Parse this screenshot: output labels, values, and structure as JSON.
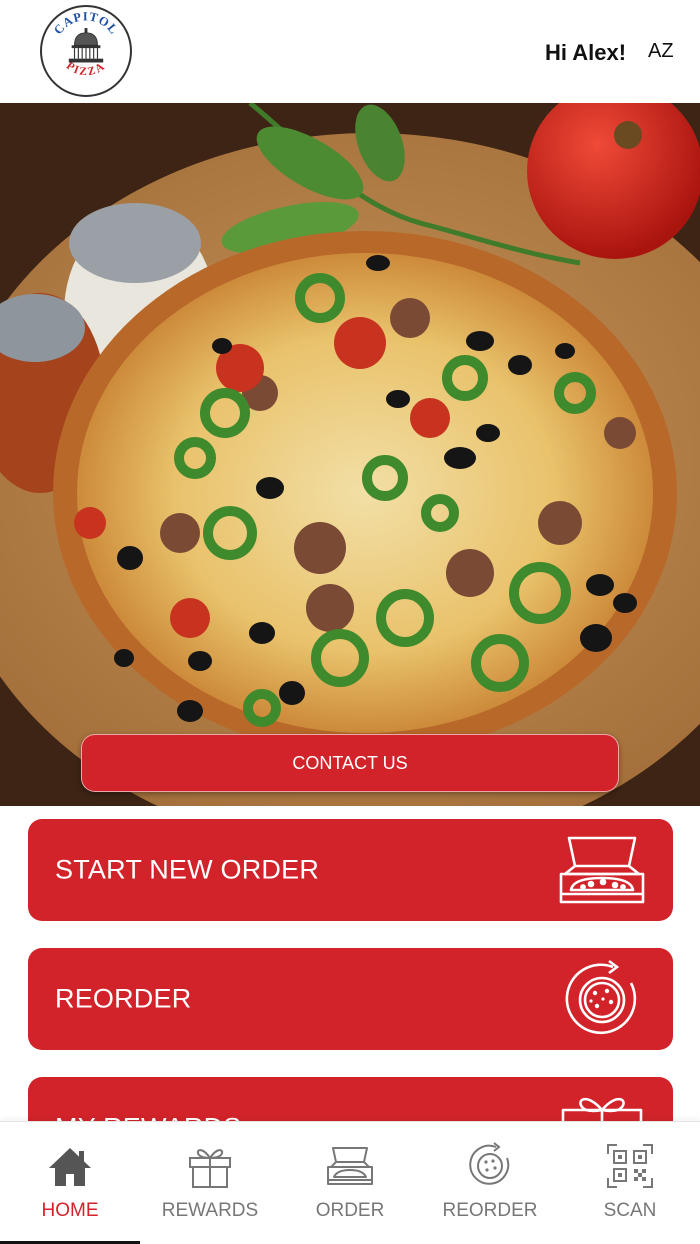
{
  "header": {
    "logo": {
      "top_text": "CAPITOL",
      "bottom_text": "PIZZA",
      "icon": "capitol-dome-icon"
    },
    "greeting": "Hi Alex!",
    "state": "AZ"
  },
  "hero": {
    "image": "pizza-photo",
    "contact_label": "CONTACT US"
  },
  "actions": [
    {
      "label": "START NEW ORDER",
      "icon": "pizza-box-icon"
    },
    {
      "label": "REORDER",
      "icon": "reorder-pizza-icon"
    },
    {
      "label": "MY REWARDS",
      "icon": "gift-icon"
    }
  ],
  "nav": {
    "items": [
      {
        "label": "HOME",
        "icon": "home-icon",
        "active": true
      },
      {
        "label": "REWARDS",
        "icon": "gift-icon",
        "active": false
      },
      {
        "label": "ORDER",
        "icon": "pizza-box-icon",
        "active": false
      },
      {
        "label": "REORDER",
        "icon": "reorder-pizza-icon",
        "active": false
      },
      {
        "label": "SCAN",
        "icon": "qr-code-icon",
        "active": false
      }
    ]
  },
  "colors": {
    "brand_red": "#d2232a",
    "inactive_gray": "#777777",
    "text_dark": "#111111"
  }
}
